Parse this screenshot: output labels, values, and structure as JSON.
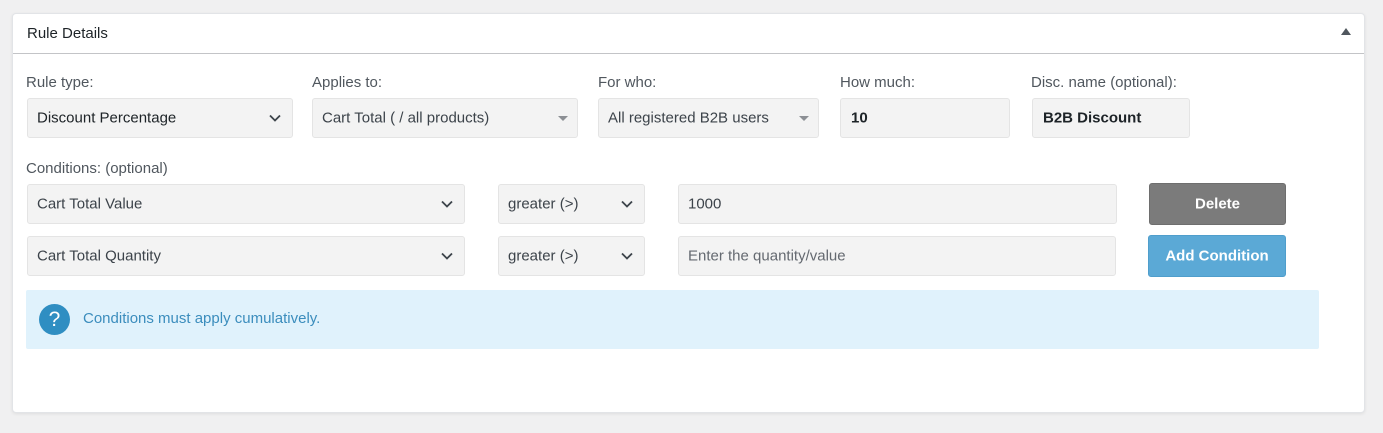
{
  "panel": {
    "title": "Rule Details"
  },
  "fields": {
    "rule_type": {
      "label": "Rule type:",
      "value": "Discount Percentage"
    },
    "applies_to": {
      "label": "Applies to:",
      "value": "Cart Total ( / all products)"
    },
    "for_who": {
      "label": "For who:",
      "value": "All registered B2B users"
    },
    "how_much": {
      "label": "How much:",
      "value": "10"
    },
    "disc_name": {
      "label": "Disc. name (optional):",
      "value": "B2B Discount"
    }
  },
  "conditions": {
    "label": "Conditions: (optional)",
    "rows": [
      {
        "type": "Cart Total Value",
        "operator": "greater (>)",
        "value": "1000",
        "placeholder": "",
        "button": "Delete"
      },
      {
        "type": "Cart Total Quantity",
        "operator": "greater (>)",
        "value": "",
        "placeholder": "Enter the quantity/value",
        "button": "Add Condition"
      }
    ]
  },
  "notice": {
    "text": "Conditions must apply cumulatively.",
    "icon": "?"
  },
  "icons": {
    "toggle": "triangle-up-icon",
    "select_arrow": "chevron-down-icon",
    "dropdown_caret": "caret-down-icon",
    "help": "question-circle-icon"
  },
  "colors": {
    "delete_button": "#7b7b7b",
    "add_button": "#5ba9d6",
    "notice_bg": "#e0f2fc",
    "notice_text": "#3b8dbd",
    "help_icon": "#2f8ec2"
  }
}
